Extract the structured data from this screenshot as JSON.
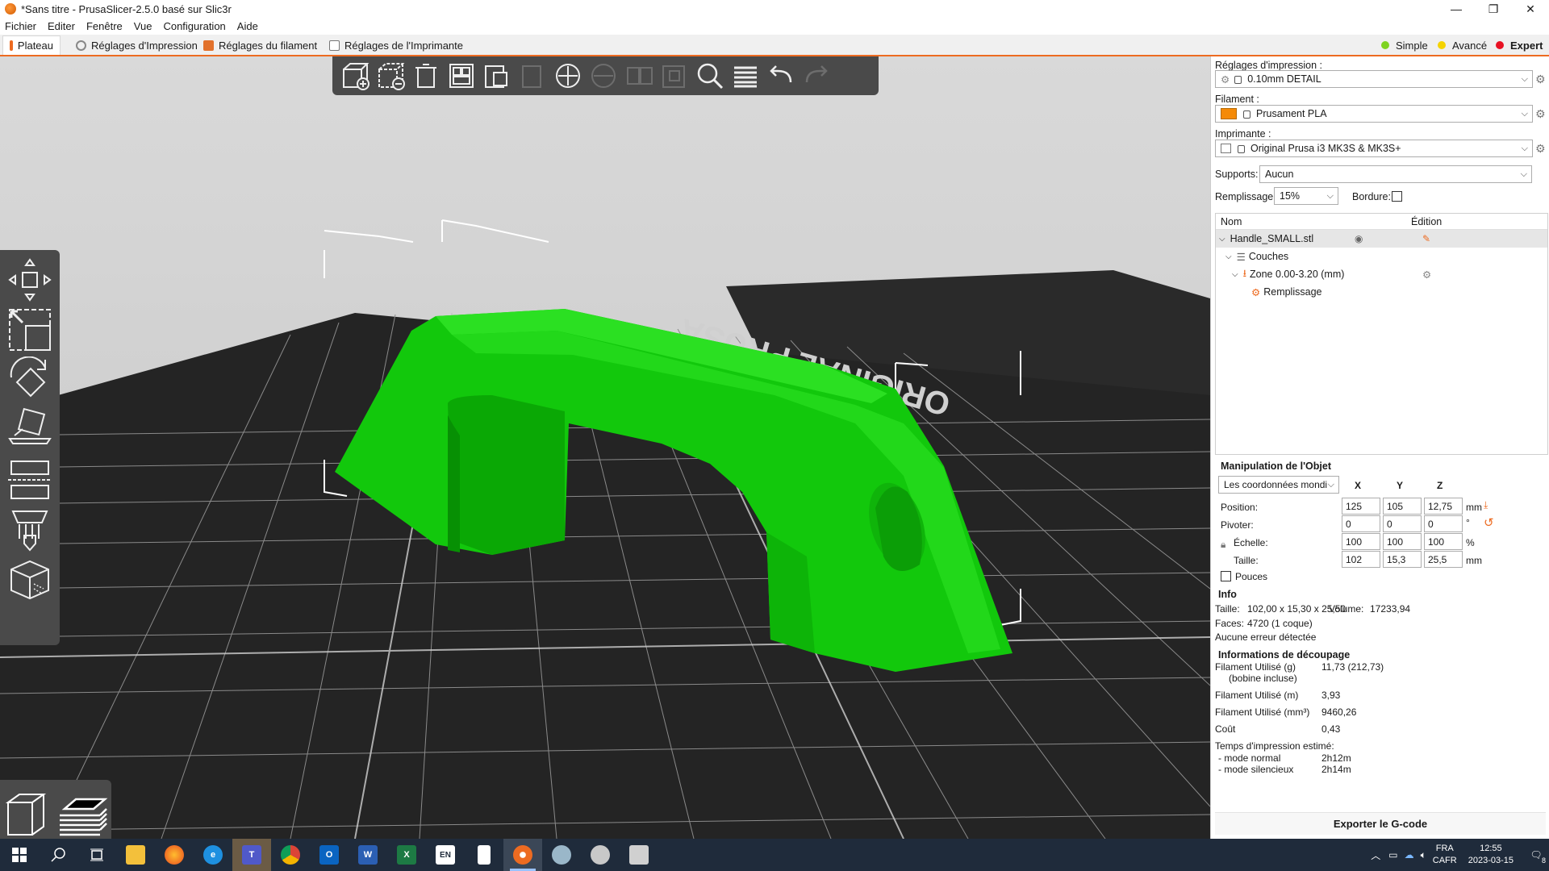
{
  "window": {
    "title": "*Sans titre - PrusaSlicer-2.5.0 basé sur Slic3r",
    "minimize": "—",
    "maximize": "❐",
    "close": "✕"
  },
  "menu": [
    "Fichier",
    "Editer",
    "Fenêtre",
    "Vue",
    "Configuration",
    "Aide"
  ],
  "tabs": {
    "plater": "Plateau",
    "print": "Réglages d'Impression",
    "filament": "Réglages du filament",
    "printer": "Réglages de l'Imprimante"
  },
  "modes": {
    "simple": "Simple",
    "advanced": "Avancé",
    "expert": "Expert",
    "colors": {
      "simple": "#7ed321",
      "advanced": "#f5d300",
      "expert": "#e81123"
    }
  },
  "bed_label": "ORIGINAL PRUSA",
  "model_color": "#10c800",
  "accent_color": "#ed6b21",
  "panel": {
    "print_settings_label": "Réglages d'impression :",
    "print_profile": "0.10mm DETAIL",
    "filament_label": "Filament :",
    "filament_profile": "Prusament PLA",
    "filament_color": "#f58a07",
    "printer_label": "Imprimante :",
    "printer_profile": "Original Prusa i3 MK3S & MK3S+",
    "supports_label": "Supports:",
    "supports_value": "Aucun",
    "infill_label": "Remplissage:",
    "infill_value": "15%",
    "brim_label": "Bordure:"
  },
  "object_list": {
    "col_name": "Nom",
    "col_edit": "Édition",
    "object_name": "Handle_SMALL.stl",
    "layers": "Couches",
    "range": "Zone 0.00-3.20 (mm)",
    "infill": "Remplissage"
  },
  "manip": {
    "title": "Manipulation de l'Objet",
    "coords": "Les coordonnées mondi",
    "x": "X",
    "y": "Y",
    "z": "Z",
    "position_label": "Position:",
    "position": [
      "125",
      "105",
      "12,75"
    ],
    "position_unit": "mm",
    "rotate_label": "Pivoter:",
    "rotate": [
      "0",
      "0",
      "0"
    ],
    "rotate_unit": "°",
    "scale_label": "Échelle:",
    "scale": [
      "100",
      "100",
      "100"
    ],
    "scale_unit": "%",
    "size_label": "Taille:",
    "size": [
      "102",
      "15,3",
      "25,5"
    ],
    "size_unit": "mm",
    "inches_label": "Pouces"
  },
  "info": {
    "title": "Info",
    "size_label": "Taille:",
    "size": "102,00 x 15,30 x 25,50",
    "volume_label": "Volume:",
    "volume": "17233,94",
    "facets_label": "Faces:",
    "facets": "4720 (1 coque)",
    "errors": "Aucune erreur détectée"
  },
  "slice_info": {
    "title": "Informations de découpage",
    "filament_g_label": "Filament Utilisé (g)",
    "filament_g_sub": "(bobine incluse)",
    "filament_g": "11,73 (212,73)",
    "filament_m_label": "Filament Utilisé (m)",
    "filament_m": "3,93",
    "filament_mm3_label": "Filament Utilisé (mm³)",
    "filament_mm3": "9460,26",
    "cost_label": "Coût",
    "cost": "0,43",
    "time_label": "Temps d'impression estimé:",
    "normal_label": "- mode normal",
    "normal": "2h12m",
    "silent_label": "- mode silencieux",
    "silent": "2h14m"
  },
  "export_button": "Exporter le G-code",
  "taskbar": {
    "lang": "FRA",
    "layout": "CAFR",
    "time": "12:55",
    "date": "2023-03-15",
    "notif": "8",
    "apps": [
      "explorer-icon",
      "firefox-icon",
      "edge-icon",
      "teams-icon",
      "chrome-icon",
      "outlook-icon",
      "word-icon",
      "excel-icon",
      "english-app-icon",
      "notepad-icon",
      "prusaslicer-icon",
      "paint-icon",
      "gcode-viewer-icon",
      "cmd-icon"
    ]
  }
}
